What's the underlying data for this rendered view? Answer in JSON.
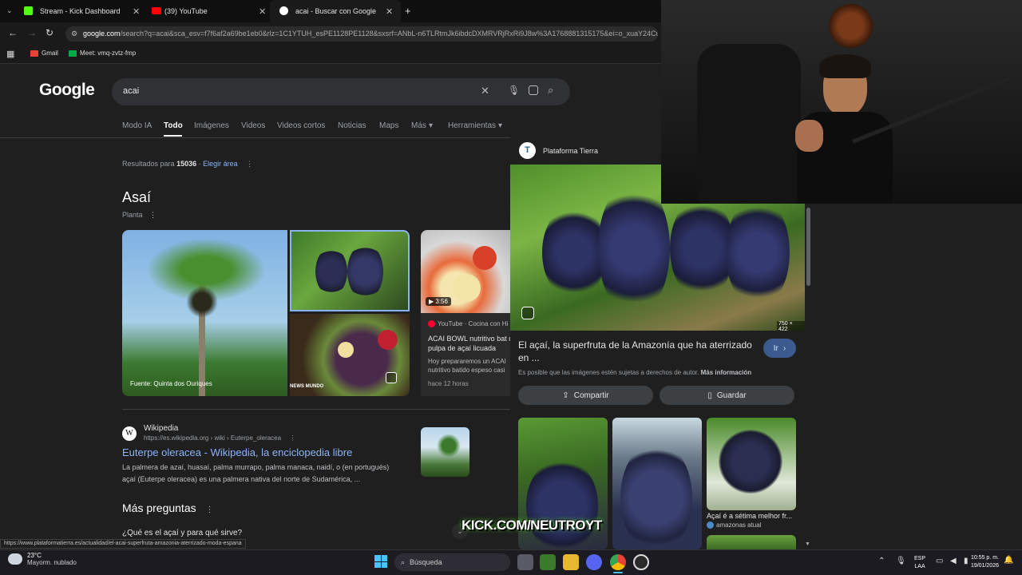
{
  "tabs": [
    {
      "title": "Stream - Kick Dashboard",
      "color": "#53fc18"
    },
    {
      "title": "(39) YouTube",
      "color": "#ff0000"
    },
    {
      "title": "acai - Buscar con Google",
      "color": "#ffffff"
    }
  ],
  "address": {
    "domain": "google.com",
    "path": "/search?q=acai&sca_esv=f7f6af2a69be1eb0&rlz=1C1YTUH_esPE1128PE1128&sxsrf=ANbL-n6TLRtmJk6ibdcDXMRVRjRxRi9J8w%3A1768881315175&ei=o_xuaY24Cu"
  },
  "bookmarks": [
    {
      "label": "Gmail"
    },
    {
      "label": "Meet: vmq-zvtz-fmp"
    }
  ],
  "search": {
    "logo": "Google",
    "query": "acai",
    "tabs": [
      "Modo IA",
      "Todo",
      "Imágenes",
      "Videos",
      "Videos cortos",
      "Noticias",
      "Maps",
      "Más",
      "Herramientas"
    ]
  },
  "results_meta": {
    "prefix": "Resultados para",
    "location": "15036",
    "change": "Elegir área"
  },
  "knowledge": {
    "title": "Asaí",
    "subtitle": "Planta",
    "caption": "Fuente: Quinta dos Ouriques",
    "news_label": "NEWS MUNDO"
  },
  "video": {
    "duration": "3:56",
    "source": "YouTube · Cocina con Hi",
    "title": "ACAI BOWL nutritivo bat de pulpa de açaí licuada",
    "snippet": "Hoy prepararemos un ACAI nutritivo batido espeso casi",
    "time": "hace 12 horas"
  },
  "wiki": {
    "site": "Wikipedia",
    "url": "https://es.wikipedia.org › wiki › Euterpe_oleracea",
    "title": "Euterpe oleracea - Wikipedia, la enciclopedia libre",
    "snippet1": "La palmera de azaí, huasaí, palma murrapo, palma manaca, naidí, o (en portugués)",
    "snippet2": "açaí (Euterpe oleracea) es una palmera nativa del norte de Sudamérica, ..."
  },
  "paa": {
    "title": "Más preguntas",
    "q1": "¿Qué es el açaí y para qué sirve?"
  },
  "panel": {
    "source": "Plataforma Tierra",
    "dimensions": "750 × 422",
    "title": "El açaí, la superfruta de la Amazonía que ha aterrizado en ...",
    "go": "Ir",
    "copyright": "Es posible que las imágenes estén sujetas a derechos de autor.",
    "more_info": "Más información",
    "share": "Compartir",
    "save": "Guardar",
    "related_caption": "Açaí é a sétima melhor fr...",
    "related_source": "amazonas atual"
  },
  "overlay": {
    "kick": "KICK.COM/NEUTROYT"
  },
  "status_url": "https://www.plataformatierra.es/actualidad/el-acai-superfruta-amazonia-aterrizado-moda-espana",
  "taskbar": {
    "temp": "23°C",
    "weather": "Mayorm. nublado",
    "search": "Búsqueda",
    "lang1": "ESP",
    "lang2": "LAA",
    "time": "10:55 p. m.",
    "date": "19/01/2026"
  }
}
